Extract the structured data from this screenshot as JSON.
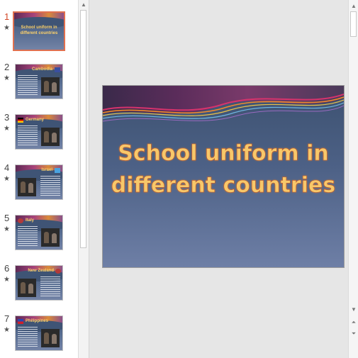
{
  "slides": [
    {
      "number": "1",
      "star": "★",
      "title": "School uniform in different countries"
    },
    {
      "number": "2",
      "star": "★",
      "country": "Cambodia"
    },
    {
      "number": "3",
      "star": "★",
      "country": "Germany"
    },
    {
      "number": "4",
      "star": "★",
      "country": "Israel"
    },
    {
      "number": "5",
      "star": "★",
      "country": "Italy"
    },
    {
      "number": "6",
      "star": "★",
      "country": "New Zealand"
    },
    {
      "number": "7",
      "star": "★",
      "country": "Philippines"
    }
  ],
  "main_slide": {
    "title": "School uniform in different countries"
  },
  "scroll_icons": {
    "up": "▲",
    "down": "▼",
    "prev_slide": "⏶",
    "next_slide": "⏷"
  },
  "colors": {
    "active_border": "#e0704f",
    "title_text": "#f7c86a",
    "slide_bg_top": "#3c5170",
    "slide_bg_bottom": "#6e7fa6"
  }
}
